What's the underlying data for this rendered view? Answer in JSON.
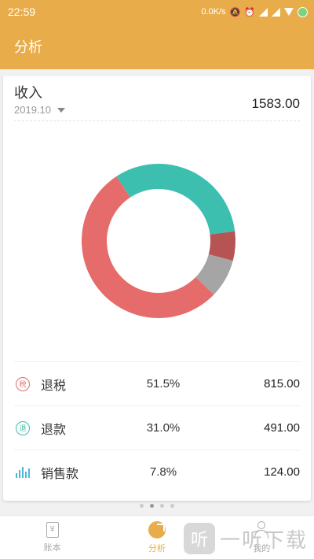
{
  "status_bar": {
    "time": "22:59",
    "network_speed": "0.0K/s",
    "icons": [
      "mute-icon",
      "alarm-icon",
      "signal-icon",
      "signal-icon",
      "wifi-icon",
      "battery-icon"
    ]
  },
  "app_bar": {
    "title": "分析"
  },
  "summary": {
    "title": "收入",
    "month": "2019.10",
    "total": "1583.00"
  },
  "chart_data": {
    "type": "pie",
    "style": "donut",
    "slices": [
      {
        "name": "退税",
        "percent": 51.5,
        "value": 815.0,
        "color": "#e66b6b"
      },
      {
        "name": "退款",
        "percent": 31.0,
        "value": 491.0,
        "color": "#3dbfb0"
      },
      {
        "name": "",
        "percent": 5.9,
        "value": 93.0,
        "color": "#b65454"
      },
      {
        "name": "销售款",
        "percent": 7.8,
        "value": 124.0,
        "color": "#a5a5a5"
      }
    ]
  },
  "legend": [
    {
      "icon_char": "税",
      "icon_color": "#e66b6b",
      "name": "退税",
      "percent": "51.5%",
      "amount": "815.00"
    },
    {
      "icon_char": "退",
      "icon_color": "#3dbfb0",
      "name": "退款",
      "percent": "31.0%",
      "amount": "491.00"
    },
    {
      "name": "销售款",
      "percent": "7.8%",
      "amount": "124.00"
    }
  ],
  "pager": {
    "count": 4,
    "active": 1
  },
  "bottom_nav": [
    {
      "label": "账本",
      "icon": "ledger-icon",
      "icon_char": "¥"
    },
    {
      "label": "分析",
      "icon": "pie-chart-icon"
    },
    {
      "label": "我的",
      "icon": "person-icon"
    }
  ],
  "watermark": {
    "logo_char": "听",
    "text": "一听下载"
  }
}
